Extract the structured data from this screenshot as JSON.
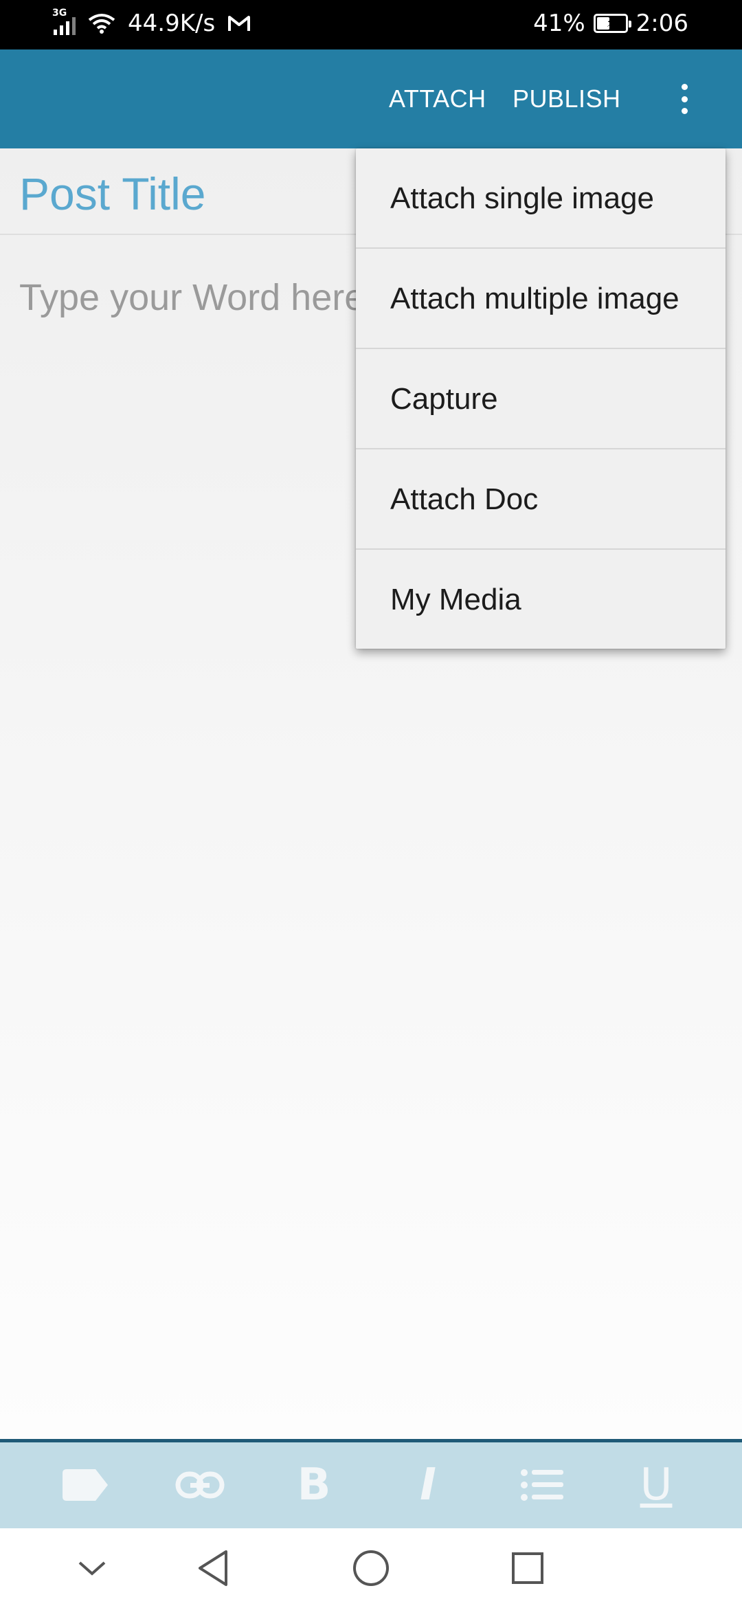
{
  "status_bar": {
    "network_type": "3G",
    "speed": "44.9K/s",
    "battery_percent": "41%",
    "battery_level": 0.41,
    "time": "2:06",
    "icons": [
      "signal-icon",
      "wifi-icon",
      "gmail-icon",
      "battery-charging-icon"
    ]
  },
  "app_bar": {
    "attach_label": "ATTACH",
    "publish_label": "PUBLISH",
    "overflow_icon": "more-vert-icon",
    "background_color": "#247ea4"
  },
  "editor": {
    "title_placeholder": "Post Title",
    "body_placeholder": "Type your Word here"
  },
  "menu": {
    "items": [
      {
        "label": "Attach single image"
      },
      {
        "label": "Attach multiple image"
      },
      {
        "label": "Capture"
      },
      {
        "label": "Attach Doc"
      },
      {
        "label": "My Media"
      }
    ]
  },
  "format_toolbar": {
    "bold_label": "B",
    "italic_label": "I",
    "underline_label": "U",
    "icons": [
      "tag-icon",
      "link-icon",
      "bold-icon",
      "italic-icon",
      "bulleted-list-icon",
      "underline-icon"
    ],
    "background_color": "#c1dce6"
  },
  "nav_bar": {
    "icons": [
      "chevron-down-icon",
      "back-icon",
      "home-icon",
      "recents-icon"
    ]
  }
}
